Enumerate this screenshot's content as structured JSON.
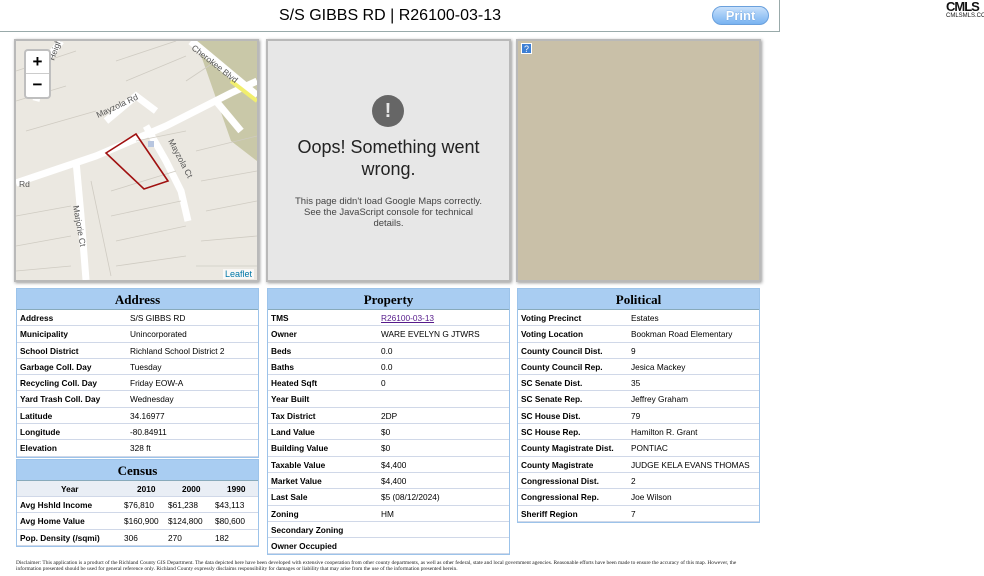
{
  "title": "S/S GIBBS RD | R26100-03-13",
  "print_label": "Print",
  "logo": {
    "text": "CMLS",
    "sub": "CMLSMLS.COM"
  },
  "map": {
    "zoom_in": "+",
    "zoom_out": "−",
    "attribution": "Leaflet",
    "street_labels": [
      "Heights Rd",
      "Cherokee Blvd",
      "Mayzola Rd",
      "Mayzola Ct",
      "Rd",
      "Marjorie Ct"
    ]
  },
  "google_error": {
    "icon": "!",
    "heading": "Oops! Something went wrong.",
    "message": "This page didn't load Google Maps correctly. See the JavaScript console for technical details."
  },
  "satellite": {
    "help_icon": "?"
  },
  "address": {
    "title": "Address",
    "rows": [
      {
        "k": "Address",
        "v": "S/S GIBBS RD"
      },
      {
        "k": "Municipality",
        "v": "Unincorporated"
      },
      {
        "k": "School District",
        "v": "Richland School District 2"
      },
      {
        "k": "Garbage Coll. Day",
        "v": "Tuesday"
      },
      {
        "k": "Recycling Coll. Day",
        "v": "Friday EOW-A"
      },
      {
        "k": "Yard Trash Coll. Day",
        "v": "Wednesday"
      },
      {
        "k": "Latitude",
        "v": "34.16977"
      },
      {
        "k": "Longitude",
        "v": "-80.84911"
      },
      {
        "k": "Elevation",
        "v": "328 ft"
      }
    ]
  },
  "census": {
    "title": "Census",
    "cols": [
      "Year",
      "2010",
      "2000",
      "1990"
    ],
    "rows": [
      {
        "k": "Avg Hshld Income",
        "v": [
          "$76,810",
          "$61,238",
          "$43,113"
        ]
      },
      {
        "k": "Avg Home Value",
        "v": [
          "$160,900",
          "$124,800",
          "$80,600"
        ]
      },
      {
        "k": "Pop. Density (/sqmi)",
        "v": [
          "306",
          "270",
          "182"
        ]
      }
    ]
  },
  "property": {
    "title": "Property",
    "rows": [
      {
        "k": "TMS",
        "v": "R26100-03-13"
      },
      {
        "k": "Owner",
        "v": "WARE EVELYN G JTWRS"
      },
      {
        "k": "Beds",
        "v": "0.0"
      },
      {
        "k": "Baths",
        "v": "0.0"
      },
      {
        "k": "Heated Sqft",
        "v": "0"
      },
      {
        "k": "Year Built",
        "v": ""
      },
      {
        "k": "Tax District",
        "v": "2DP"
      },
      {
        "k": "Land Value",
        "v": "$0"
      },
      {
        "k": "Building Value",
        "v": "$0"
      },
      {
        "k": "Taxable Value",
        "v": "$4,400"
      },
      {
        "k": "Market Value",
        "v": "$4,400"
      },
      {
        "k": "Last Sale",
        "v": "$5 (08/12/2024)"
      },
      {
        "k": "Zoning",
        "v": "HM"
      },
      {
        "k": "Secondary Zoning",
        "v": ""
      },
      {
        "k": "Owner Occupied",
        "v": ""
      }
    ]
  },
  "political": {
    "title": "Political",
    "rows": [
      {
        "k": "Voting Precinct",
        "v": "Estates"
      },
      {
        "k": "Voting Location",
        "v": "Bookman Road Elementary"
      },
      {
        "k": "County Council Dist.",
        "v": "9"
      },
      {
        "k": "County Council Rep.",
        "v": "Jesica Mackey"
      },
      {
        "k": "SC Senate Dist.",
        "v": "35"
      },
      {
        "k": "SC Senate Rep.",
        "v": "Jeffrey Graham"
      },
      {
        "k": "SC House Dist.",
        "v": "79"
      },
      {
        "k": "SC House Rep.",
        "v": "Hamilton R. Grant"
      },
      {
        "k": "County Magistrate Dist.",
        "v": "PONTIAC"
      },
      {
        "k": "County Magistrate",
        "v": "JUDGE KELA EVANS THOMAS"
      },
      {
        "k": "Congressional Dist.",
        "v": "2"
      },
      {
        "k": "Congressional Rep.",
        "v": "Joe Wilson"
      },
      {
        "k": "Sheriff Region",
        "v": "7"
      }
    ]
  },
  "disclaimer": "Disclaimer: This application is a product of the Richland County GIS Department. The data depicted here have been developed with extensive cooperation from other county departments, as well as other federal, state and local government agencies. Reasonable efforts have been made to ensure the accuracy of this map. However, the information presented should be used for general reference only. Richland County expressly disclaims responsibility for damages or liability that may arise from the use of the information presented herein."
}
